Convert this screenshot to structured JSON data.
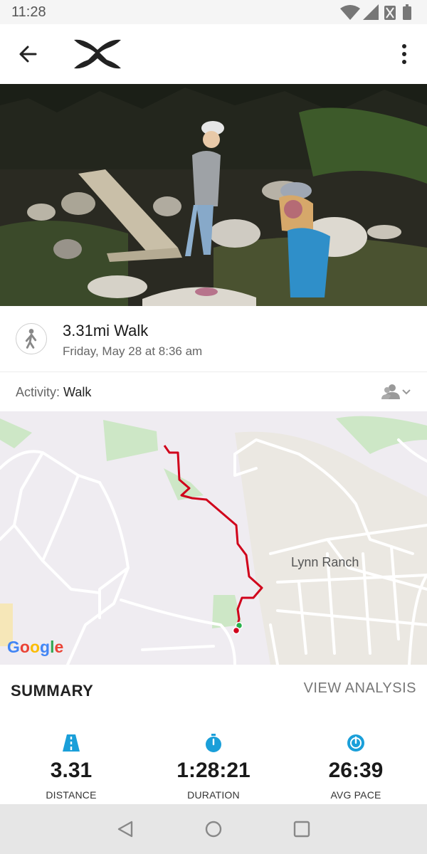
{
  "status_bar": {
    "time": "11:28"
  },
  "app_bar": {
    "brand": "under-armour-logo"
  },
  "activity": {
    "title": "3.31mi Walk",
    "date": "Friday, May 28 at 8:36 am",
    "type_label": "Activity:",
    "type_value": "Walk"
  },
  "map": {
    "place_label": "Lynn Ranch",
    "attribution": [
      "G",
      "o",
      "o",
      "g",
      "l",
      "e"
    ],
    "route_color": "#d0021b"
  },
  "summary": {
    "title": "SUMMARY",
    "view_analysis": "VIEW ANALYSIS"
  },
  "stats": [
    {
      "value": "3.31",
      "label": "DISTANCE",
      "icon": "road-icon"
    },
    {
      "value": "1:28:21",
      "label": "DURATION",
      "icon": "stopwatch-icon"
    },
    {
      "value": "26:39",
      "label": "AVG PACE",
      "icon": "speedometer-icon"
    }
  ],
  "colors": {
    "accent": "#1a9fd9"
  }
}
